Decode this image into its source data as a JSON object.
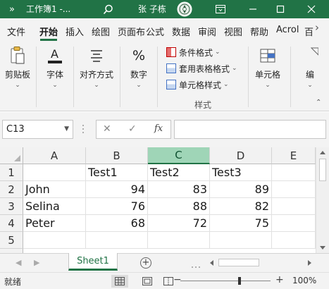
{
  "titlebar": {
    "quick_access": "»",
    "file_name": "工作簿1 -...",
    "user": "张 子栋"
  },
  "ribbon_tabs": [
    "文件",
    "开始",
    "插入",
    "绘图",
    "页面布",
    "公式",
    "数据",
    "审阅",
    "视图",
    "帮助",
    "Acrol",
    "百"
  ],
  "ribbon": {
    "clipboard": "剪贴板",
    "font": "字体",
    "alignment": "对齐方式",
    "number": "数字",
    "number_symbol": "%",
    "conditional_formatting": "条件格式",
    "format_as_table": "套用表格格式",
    "cell_styles": "单元格样式",
    "styles_group": "样式",
    "cells": "单元格",
    "editing_partial": "编"
  },
  "formula_bar": {
    "name_box": "C13",
    "fx": "fx",
    "formula": ""
  },
  "sheet": {
    "columns": [
      "A",
      "B",
      "C",
      "D",
      "E"
    ],
    "selected_column": "C",
    "rows": [
      {
        "n": "1",
        "a": "",
        "b": "Test1",
        "c": "Test2",
        "d": "Test3",
        "e": ""
      },
      {
        "n": "2",
        "a": "John",
        "b": "94",
        "c": "83",
        "d": "89",
        "e": ""
      },
      {
        "n": "3",
        "a": "Selina",
        "b": "76",
        "c": "88",
        "d": "82",
        "e": ""
      },
      {
        "n": "4",
        "a": "Peter",
        "b": "68",
        "c": "72",
        "d": "75",
        "e": ""
      },
      {
        "n": "5",
        "a": "",
        "b": "",
        "c": "",
        "d": "",
        "e": ""
      }
    ]
  },
  "sheet_tabs": {
    "active": "Sheet1",
    "add": "+"
  },
  "status": {
    "ready": "就绪",
    "zoom_out": "−",
    "zoom_in": "+",
    "zoom": "100%"
  }
}
